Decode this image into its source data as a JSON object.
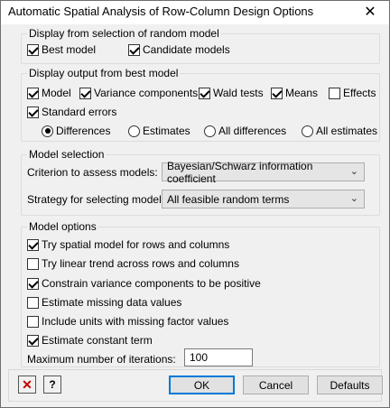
{
  "window": {
    "title": "Automatic Spatial Analysis of Row-Column Design Options",
    "close_glyph": "✕"
  },
  "random_model": {
    "title": "Display from selection of random model",
    "best_model": {
      "label": "Best model",
      "checked": true
    },
    "candidate_models": {
      "label": "Candidate models",
      "checked": true
    }
  },
  "best_model_output": {
    "title": "Display output from best model",
    "checkboxes": [
      {
        "label": "Model",
        "checked": true
      },
      {
        "label": "Variance components",
        "checked": true
      },
      {
        "label": "Wald tests",
        "checked": true
      },
      {
        "label": "Means",
        "checked": true
      },
      {
        "label": "Effects",
        "checked": false
      },
      {
        "label": "Standard errors",
        "checked": true
      }
    ],
    "radios": [
      {
        "label": "Differences",
        "checked": true
      },
      {
        "label": "Estimates",
        "checked": false
      },
      {
        "label": "All differences",
        "checked": false
      },
      {
        "label": "All estimates",
        "checked": false
      }
    ]
  },
  "model_selection": {
    "title": "Model selection",
    "criterion_label": "Criterion to assess models:",
    "criterion_value": "Bayesian/Schwarz information coefficient",
    "strategy_label": "Strategy for selecting model:",
    "strategy_value": "All feasible random terms"
  },
  "model_options": {
    "title": "Model options",
    "checkboxes": [
      {
        "label": "Try spatial model for rows and columns",
        "checked": true
      },
      {
        "label": "Try linear trend across rows and columns",
        "checked": false
      },
      {
        "label": "Constrain variance components to be positive",
        "checked": true
      },
      {
        "label": "Estimate missing data values",
        "checked": false
      },
      {
        "label": "Include units with missing factor values",
        "checked": false
      },
      {
        "label": "Estimate constant term",
        "checked": true
      }
    ],
    "max_iter_label": "Maximum number of iterations:",
    "max_iter_value": "100"
  },
  "buttons": {
    "ok": "OK",
    "cancel": "Cancel",
    "defaults": "Defaults",
    "clear_glyph": "✕",
    "help_glyph": "?"
  },
  "colors": {
    "accent": "#0078d7",
    "clear_icon": "#c00000"
  }
}
